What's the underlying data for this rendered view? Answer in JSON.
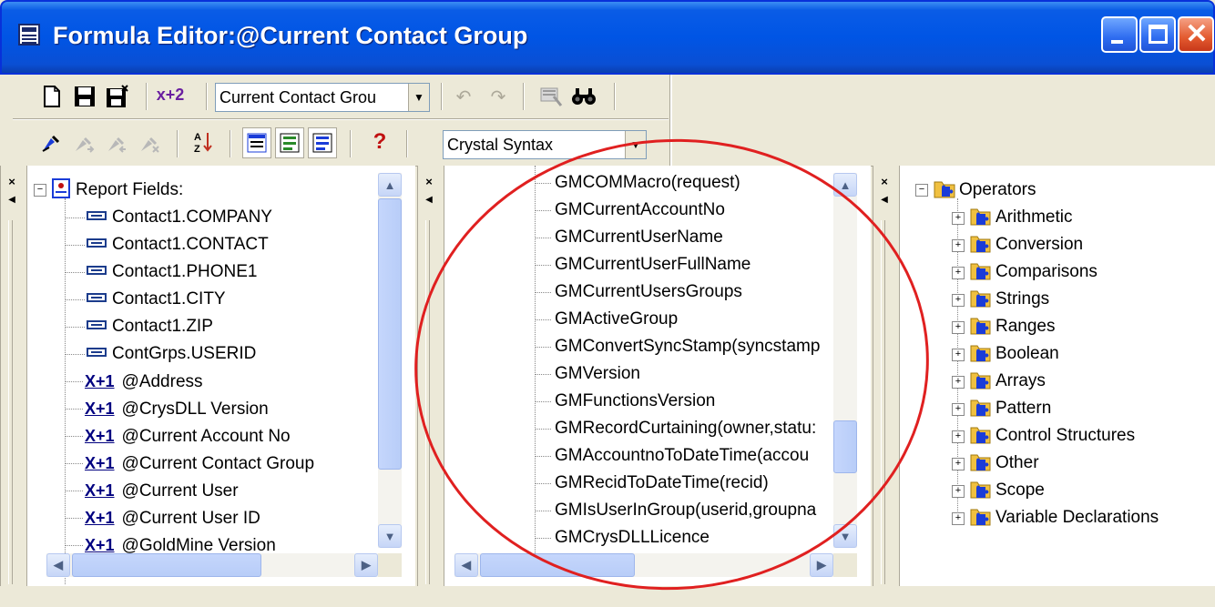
{
  "window": {
    "title": "Formula Editor:@Current Contact Group",
    "minimize_label": "_",
    "maximize_label": "□",
    "close_label": "X"
  },
  "toolbar1": {
    "new_icon": "new-document-icon",
    "save_icon": "save-icon",
    "save_and_close_icon": "save-and-close-icon",
    "check_icon": "check-formula-icon",
    "check_label": "x+2",
    "formula_combo_value": "Current Contact Grou",
    "undo_icon": "undo-icon",
    "redo_icon": "redo-icon",
    "browse_icon": "browse-data-icon",
    "find_icon": "find-icon"
  },
  "toolbar2": {
    "bookmark_icon": "toggle-bookmark-icon",
    "next_bookmark_icon": "next-bookmark-icon",
    "prev_bookmark_icon": "previous-bookmark-icon",
    "clear_bookmarks_icon": "clear-bookmarks-icon",
    "sort_icon": "sort-trees-icon",
    "toggle_fields_icon": "toggle-field-tree-icon",
    "toggle_functions_icon": "toggle-function-tree-icon",
    "toggle_operators_icon": "toggle-operator-tree-icon",
    "help_label": "?",
    "syntax_combo_value": "Crystal Syntax"
  },
  "fields_pane": {
    "root_label": "Report Fields:",
    "items": [
      {
        "kind": "field",
        "label": "Contact1.COMPANY"
      },
      {
        "kind": "field",
        "label": "Contact1.CONTACT"
      },
      {
        "kind": "field",
        "label": "Contact1.PHONE1"
      },
      {
        "kind": "field",
        "label": "Contact1.CITY"
      },
      {
        "kind": "field",
        "label": "Contact1.ZIP"
      },
      {
        "kind": "field",
        "label": "ContGrps.USERID"
      },
      {
        "kind": "formula",
        "label": "@Address"
      },
      {
        "kind": "formula",
        "label": "@CrysDLL Version"
      },
      {
        "kind": "formula",
        "label": "@Current Account No"
      },
      {
        "kind": "formula",
        "label": "@Current Contact Group"
      },
      {
        "kind": "formula",
        "label": "@Current User"
      },
      {
        "kind": "formula",
        "label": "@Current User ID"
      },
      {
        "kind": "formula",
        "label": "@GoldMine Version"
      }
    ],
    "formula_icon_label": "X+1",
    "scroll_fraction": 0.0
  },
  "functions_pane": {
    "items": [
      "GMCOMMacro(request)",
      "GMCurrentAccountNo",
      "GMCurrentUserName",
      "GMCurrentUserFullName",
      "GMCurrentUsersGroups",
      "GMActiveGroup",
      "GMConvertSyncStamp(syncstamp",
      "GMVersion",
      "GMFunctionsVersion",
      "GMRecordCurtaining(owner,statu:",
      "GMAccountnoToDateTime(accou",
      "GMRecidToDateTime(recid)",
      "GMIsUserInGroup(userid,groupna",
      "GMCrysDLLLicence"
    ]
  },
  "operators_pane": {
    "root_label": "Operators",
    "items": [
      "Arithmetic",
      "Conversion",
      "Comparisons",
      "Strings",
      "Ranges",
      "Boolean",
      "Arrays",
      "Pattern",
      "Control Structures",
      "Other",
      "Scope",
      "Variable Declarations"
    ]
  },
  "scrollbars": {
    "up_arrow": "▲",
    "down_arrow": "▼",
    "left_arrow": "◀",
    "right_arrow": "▶"
  },
  "pane_strip": {
    "close_label": "x",
    "arrow_label": "◀"
  },
  "colors": {
    "title_blue": "#0055e5",
    "annotation_red": "#e02020",
    "operator_blue": "#1a3cd8"
  }
}
